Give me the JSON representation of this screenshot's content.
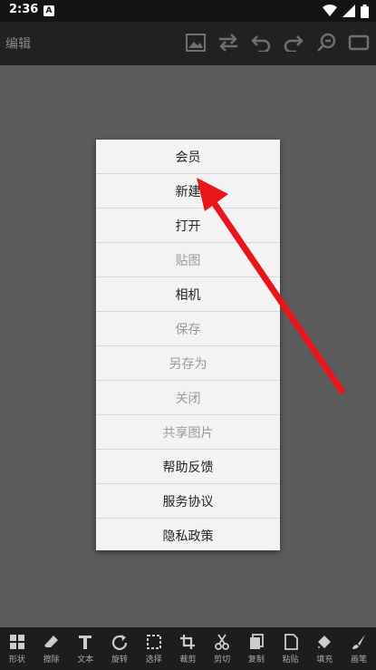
{
  "status_bar": {
    "time": "2:36",
    "notification_letter": "A",
    "icons": [
      "wifi-icon",
      "signal-icon",
      "battery-icon"
    ]
  },
  "toolbar": {
    "title": "编辑",
    "icons": [
      "image-icon",
      "swap-icon",
      "undo-icon",
      "redo-icon",
      "zoom-out-icon",
      "fullscreen-icon"
    ]
  },
  "menu": {
    "items": [
      {
        "label": "会员",
        "enabled": true
      },
      {
        "label": "新建",
        "enabled": true
      },
      {
        "label": "打开",
        "enabled": true
      },
      {
        "label": "贴图",
        "enabled": false
      },
      {
        "label": "相机",
        "enabled": true
      },
      {
        "label": "保存",
        "enabled": false
      },
      {
        "label": "另存为",
        "enabled": false
      },
      {
        "label": "关闭",
        "enabled": false
      },
      {
        "label": "共享图片",
        "enabled": false
      },
      {
        "label": "帮助反馈",
        "enabled": true
      },
      {
        "label": "服务协议",
        "enabled": true
      },
      {
        "label": "隐私政策",
        "enabled": true
      }
    ]
  },
  "bottom_toolbar": {
    "items": [
      {
        "label": "形状",
        "icon": "shape-grid-icon"
      },
      {
        "label": "擦除",
        "icon": "eraser-icon"
      },
      {
        "label": "文本",
        "icon": "text-icon"
      },
      {
        "label": "旋转",
        "icon": "rotate-icon"
      },
      {
        "label": "选择",
        "icon": "select-icon"
      },
      {
        "label": "裁剪",
        "icon": "crop-icon"
      },
      {
        "label": "剪切",
        "icon": "scissors-icon"
      },
      {
        "label": "复制",
        "icon": "copy-icon"
      },
      {
        "label": "粘贴",
        "icon": "paste-icon"
      },
      {
        "label": "填充",
        "icon": "fill-icon"
      },
      {
        "label": "画笔",
        "icon": "brush-icon"
      }
    ]
  },
  "colors": {
    "status_bar": "#141414",
    "toolbar": "#212121",
    "canvas": "#5b5b5b",
    "menu_bg": "#f3f3f3",
    "disabled_text": "#9a9a9a",
    "annotation_arrow": "#e8161b"
  }
}
